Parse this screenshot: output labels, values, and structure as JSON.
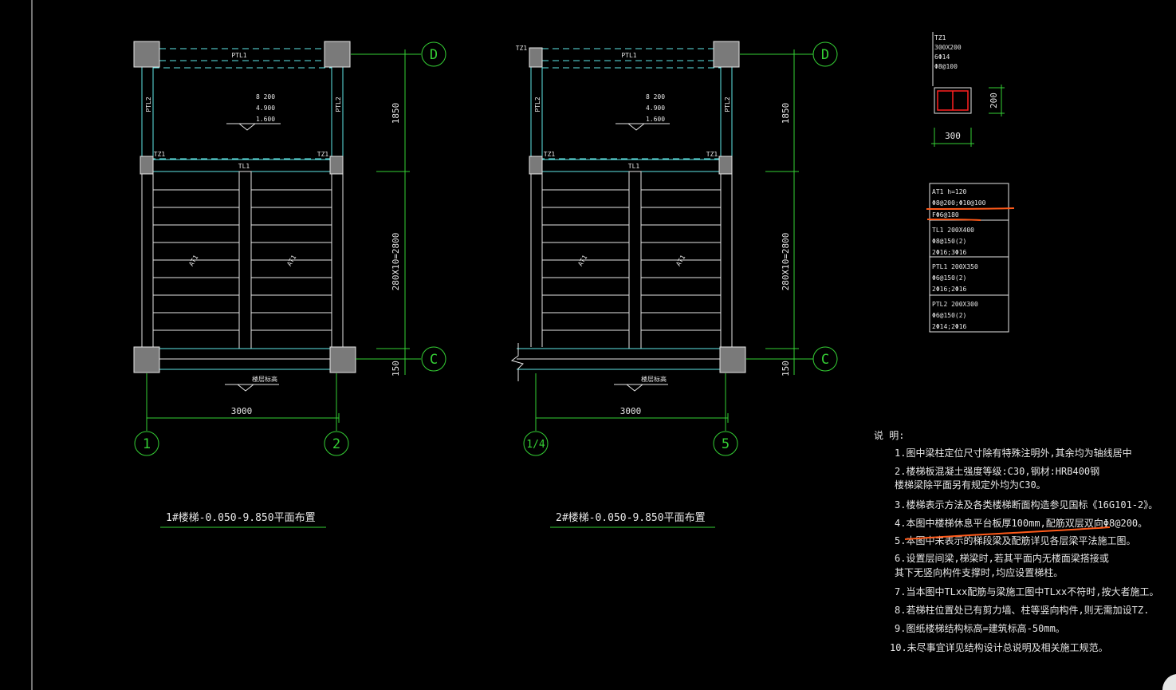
{
  "drawing": {
    "plans": [
      {
        "title": "1#楼梯-0.050-9.850平面布置",
        "axes_x": [
          "1",
          "2"
        ],
        "axes_y": [
          "D",
          "C"
        ],
        "beam_top": "PTL1",
        "beam_mid": "TL1",
        "beam_side_left": "PTL2",
        "beam_side_right": "PTL2",
        "column_labels": [
          "TZ1",
          "TZ1"
        ],
        "top_column_label": "",
        "slab_note": [
          "8 200",
          "4.900",
          "1.600"
        ],
        "run_labels": [
          "AT1",
          "AT1"
        ],
        "level_label": "楼层标高",
        "dim_width": "3000",
        "dim_landing": "1850",
        "dim_flight": "280X10=2800",
        "dim_bottom": "150"
      },
      {
        "title": "2#楼梯-0.050-9.850平面布置",
        "axes_x": [
          "1/4",
          "5"
        ],
        "axes_y": [
          "D",
          "C"
        ],
        "beam_top": "PTL1",
        "beam_mid": "TL1",
        "beam_side_left": "PTL2",
        "beam_side_right": "PTL2",
        "column_labels": [
          "TZ1",
          "TZ1"
        ],
        "top_column_label": "TZ1",
        "slab_note": [
          "8 200",
          "4.900",
          "1.600"
        ],
        "run_labels": [
          "AT1",
          "AT1"
        ],
        "level_label": "楼层标高",
        "dim_width": "3000",
        "dim_landing": "1850",
        "dim_flight": "280X10=2800",
        "dim_bottom": "150"
      }
    ],
    "column_detail": {
      "lines": [
        "TZ1",
        "300X200",
        "6Φ14",
        "Φ8@100"
      ],
      "dim_w": "300",
      "dim_h": "200"
    },
    "member_table": [
      [
        "AT1 h=120",
        "Φ8@200;Φ10@100",
        "FΦ6@180"
      ],
      [
        "TL1 200X400",
        "Φ8@150(2)",
        "2Φ16;3Φ16"
      ],
      [
        "PTL1 200X350",
        "Φ6@150(2)",
        "2Φ16;2Φ16"
      ],
      [
        "PTL2 200X300",
        "Φ6@150(2)",
        "2Φ14;2Φ16"
      ]
    ],
    "notes_title": "说 明:",
    "notes": [
      "1.图中梁柱定位尺寸除有特殊注明外,其余均为轴线居中",
      "2.楼梯板混凝土强度等级:C30,钢材:HRB400钢",
      "   楼梯梁除平面另有规定外均为C30。",
      "3.楼梯表示方法及各类楼梯断面构造参见国标《16G101-2》。",
      "4.本图中楼梯休息平台板厚100mm,配筋双层双向Φ8@200。",
      "5.本图中未表示的梯段梁及配筋详见各层梁平法施工图。",
      "6.设置层间梁,梯梁时,若其平面内无楼面梁搭接或",
      "   其下无竖向构件支撑时,均应设置梯柱。",
      "7.当本图中TLxx配筋与梁施工图中TLxx不符时,按大者施工。",
      "8.若梯柱位置处已有剪力墙、柱等竖向构件,则无需加设TZ.",
      "9.图纸楼梯结构标高=建筑标高-50mm。",
      "10.未尽事宜详见结构设计总说明及相关施工规范。"
    ],
    "colors": {
      "background": "#000000",
      "axis": "#35d035",
      "beam": "#5fe8e8",
      "column": "#7a7a7a",
      "text": "#e6e6e6",
      "rebar": "#ff2020",
      "markup": "#ff5a1a"
    }
  }
}
